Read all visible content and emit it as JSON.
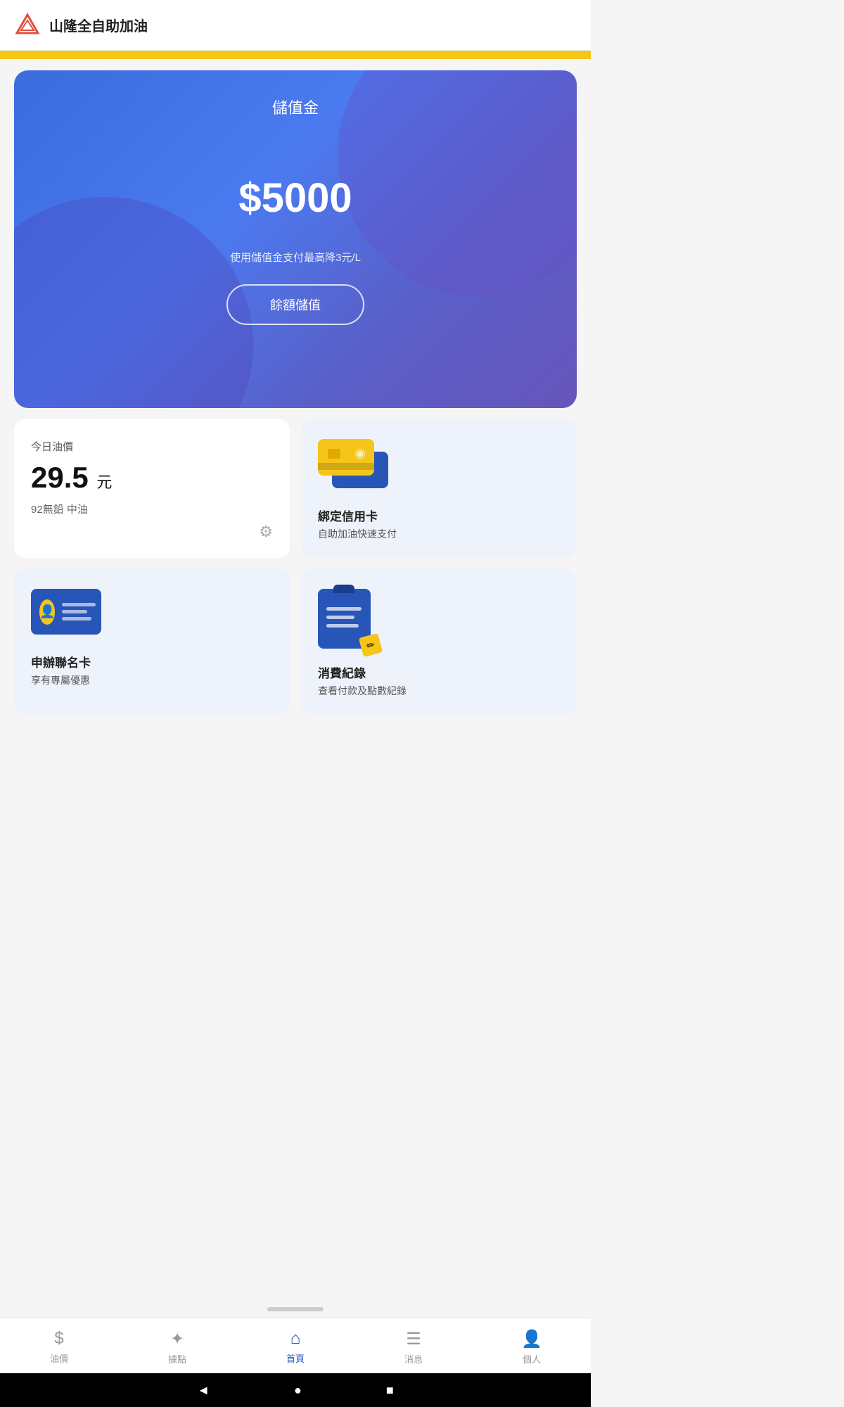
{
  "app": {
    "title": "山隆全自助加油",
    "logo_alt": "triangle-logo"
  },
  "header": {
    "title": "山隆全自助加油"
  },
  "balance_card": {
    "label": "儲值金",
    "amount": "$5000",
    "hint": "使用儲值金支付最高降3元/L",
    "button_label": "餘額儲值"
  },
  "oil_price": {
    "today_label": "今日油價",
    "value": "29.5",
    "unit": "元",
    "type": "92無鉛 中油"
  },
  "credit_card": {
    "title": "綁定信用卡",
    "subtitle": "自助加油快速支付"
  },
  "member_card": {
    "title": "申辦聯名卡",
    "subtitle": "享有專屬優惠"
  },
  "transaction": {
    "title": "消費紀錄",
    "subtitle": "查看付款及點數紀錄"
  },
  "bottom_nav": {
    "items": [
      {
        "key": "oil",
        "label": "油價",
        "icon": "$",
        "active": false
      },
      {
        "key": "spots",
        "label": "據點",
        "icon": "✦",
        "active": false
      },
      {
        "key": "home",
        "label": "首頁",
        "icon": "⌂",
        "active": true
      },
      {
        "key": "news",
        "label": "消息",
        "icon": "☰",
        "active": false
      },
      {
        "key": "profile",
        "label": "個人",
        "icon": "👤",
        "active": false
      }
    ]
  }
}
